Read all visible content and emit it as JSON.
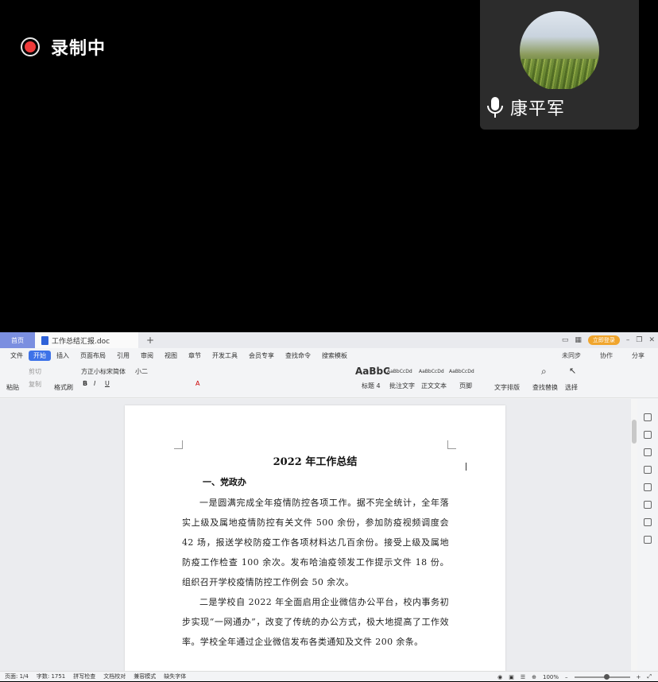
{
  "meeting": {
    "recording_label": "录制中",
    "participant_name": "康平军"
  },
  "tabs": {
    "home": "首页",
    "document": "工作总结汇报.doc",
    "login": "立即登录"
  },
  "menu": {
    "items": [
      "文件",
      "开始",
      "插入",
      "页面布局",
      "引用",
      "审阅",
      "视图",
      "章节",
      "开发工具",
      "会员专享",
      "查找命令",
      "搜索模板"
    ],
    "active": "开始",
    "right": [
      "未同步",
      "协作",
      "分享"
    ]
  },
  "ribbon": {
    "cut": "剪切",
    "copy": "复制",
    "paste": "粘贴",
    "format_painter": "格式刷",
    "font": "方正小标宋简体",
    "font_size": "小二",
    "styles": [
      {
        "sample": "AaBbC",
        "name": "标题 4"
      },
      {
        "sample": "AaBbCcDd",
        "name": "批注文字"
      },
      {
        "sample": "AaBbCcDd",
        "name": "正文文本"
      },
      {
        "sample": "AaBbCcDd",
        "name": "页脚"
      }
    ],
    "text_layout": "文字排版",
    "find_replace": "查找替换",
    "select": "选择"
  },
  "document": {
    "title": "2022 年工作总结",
    "heading": "一、党政办",
    "paragraph1": "一是圆满完成全年疫情防控各项工作。据不完全统计，全年落实上级及属地疫情防控有关文件 500 余份，参加防疫视频调度会 42 场，报送学校防疫工作各项材料达几百余份。接受上级及属地防疫工作检查 100 余次。发布哈油疫领发工作提示文件 18 份。组织召开学校疫情防控工作例会 50 余次。",
    "paragraph2": "二是学校自 2022 年全面启用企业微信办公平台，校内事务初步实现“一网通办”，改变了传统的办公方式，极大地提高了工作效率。学校全年通过企业微信发布各类通知及文件 200 余条。"
  },
  "status": {
    "page": "页面: 1/4",
    "words": "字数: 1751",
    "spell": "拼写检查",
    "proof": "文档校对",
    "compat": "兼容模式",
    "missing_font": "缺失字体",
    "zoom": "100%",
    "zoom_level": 0.6
  },
  "colors": {
    "record_red": "#ee3b3b",
    "accent_blue": "#3d72e8",
    "home_tab": "#7b8fe0",
    "login_orange": "#f0a52d"
  }
}
